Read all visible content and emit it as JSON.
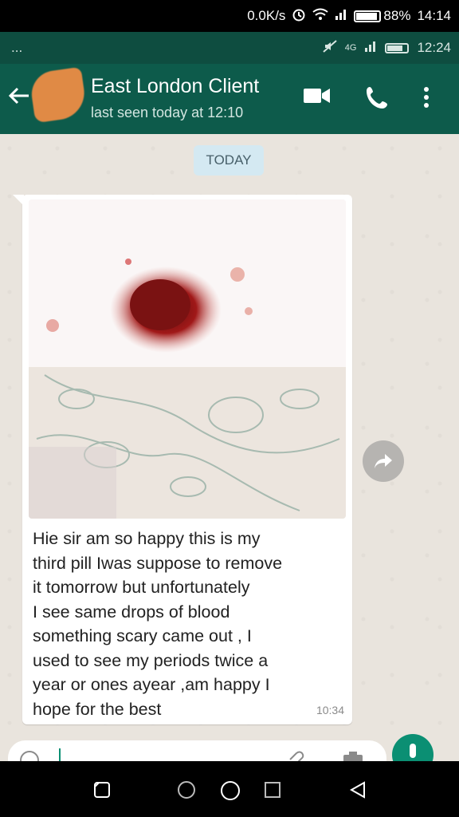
{
  "phone_status": {
    "speed": "0.0K/s",
    "battery": "88%",
    "time": "14:14"
  },
  "whatsapp_status": {
    "menu": "...",
    "network": "4G",
    "time": "12:24"
  },
  "header": {
    "contact_name": "East London Client",
    "last_seen": "last seen today at 12:10"
  },
  "chat": {
    "date_divider": "TODAY",
    "message": {
      "text": "Hie sir am so happy this is my\nthird pill Iwas suppose to remove\nit tomorrow but unfortunately\nI see same drops of blood\nsomething scary came out  , I\nused to see my periods twice a\nyear  or ones ayear  ,am happy  I\nhope for the best",
      "time": "10:34",
      "image_icon": "photo-attachment"
    }
  },
  "colors": {
    "header": "#0d5b4b",
    "status": "#0e4d40",
    "accent": "#0b8f73",
    "chat_bg": "#e9e4dd"
  }
}
